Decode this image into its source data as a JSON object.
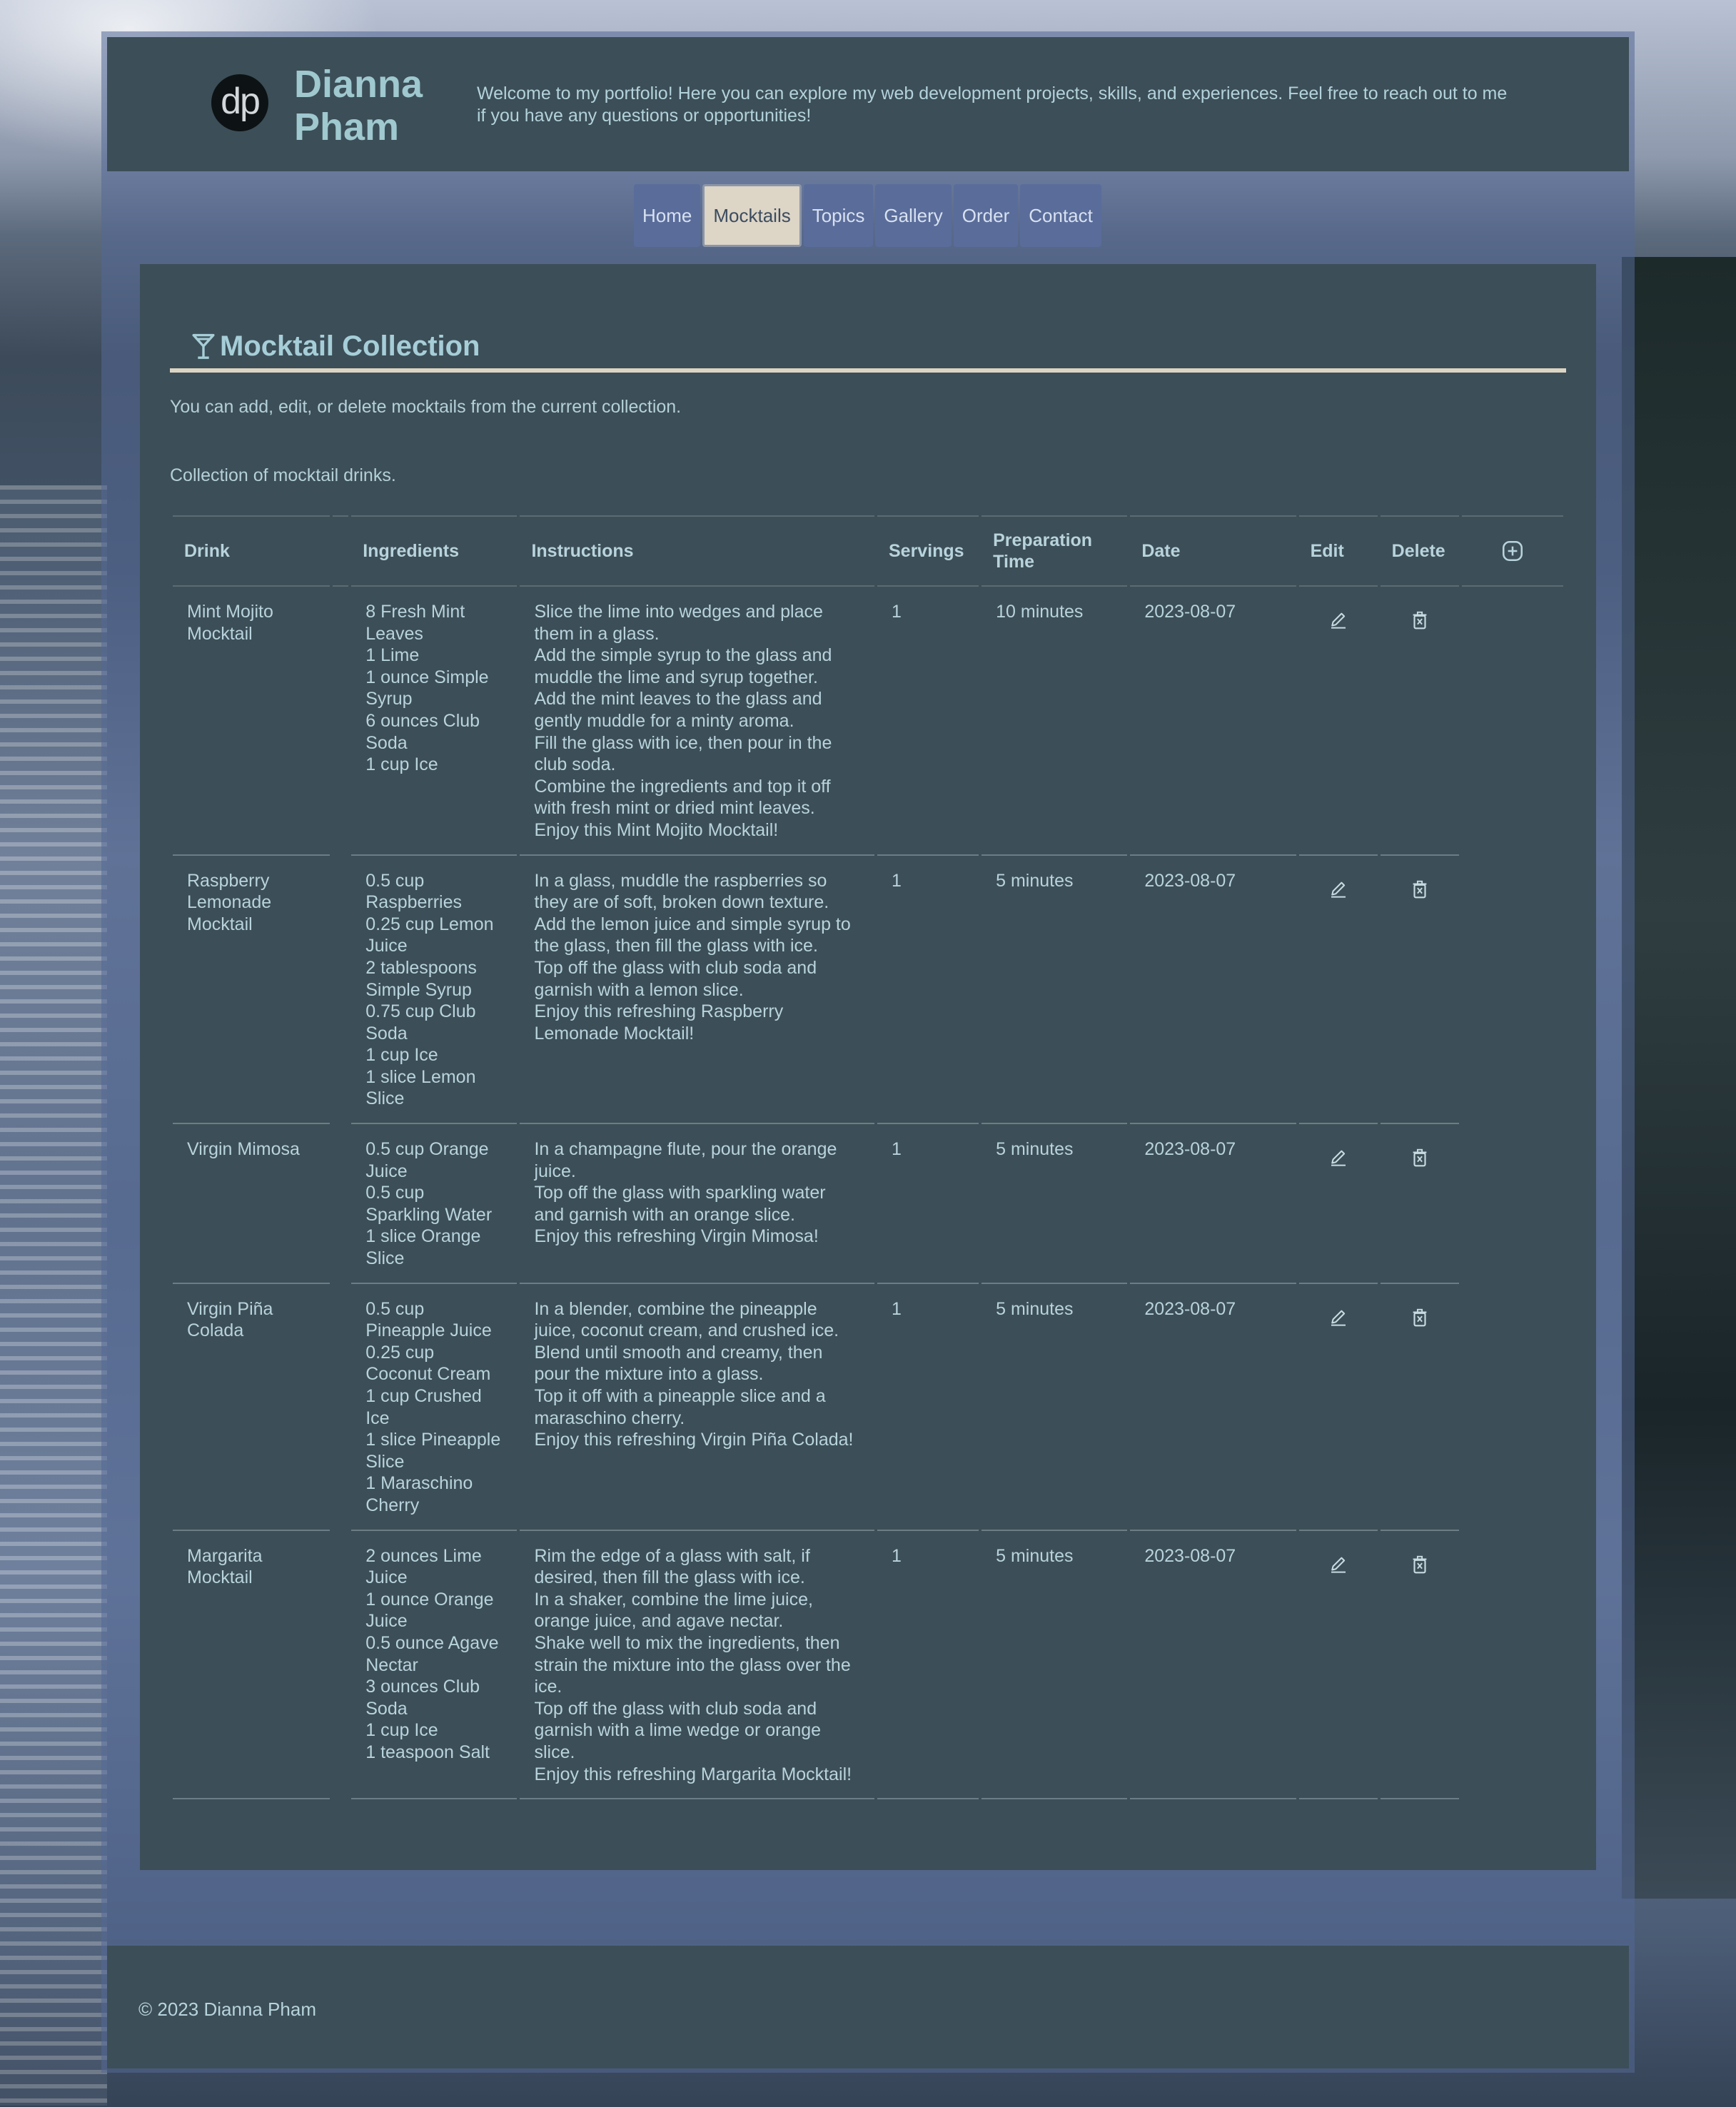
{
  "header": {
    "logo_text": "dp",
    "name_line1": "Dianna",
    "name_line2": "Pham",
    "welcome": "Welcome to my portfolio! Here you can explore my web development projects, skills, and experiences. Feel free to reach out to me if you have any questions or opportunities!"
  },
  "nav": {
    "items": [
      {
        "label": "Home"
      },
      {
        "label": "Mocktails"
      },
      {
        "label": "Topics"
      },
      {
        "label": "Gallery"
      },
      {
        "label": "Order"
      },
      {
        "label": "Contact"
      }
    ],
    "active": "Mocktails"
  },
  "main": {
    "title": "Mocktail Collection",
    "title_icon": "cocktail-glass-icon",
    "intro": "You can add, edit, or delete mocktails from the current collection.",
    "caption": "Collection of mocktail drinks."
  },
  "table": {
    "headers": {
      "drink": "Drink",
      "ingredients": "Ingredients",
      "instructions": "Instructions",
      "servings": "Servings",
      "prep_time": "Preparation Time",
      "date": "Date",
      "edit": "Edit",
      "delete": "Delete",
      "add_icon": "plus-circle-icon"
    },
    "rows": [
      {
        "drink": "Mint Mojito Mocktail",
        "ingredients": [
          "8 Fresh Mint Leaves",
          "1 Lime",
          "1 ounce Simple Syrup",
          "6 ounces Club Soda",
          "1 cup Ice"
        ],
        "instructions": [
          "Slice the lime into wedges and place them in a glass.",
          "Add the simple syrup to the glass and muddle the lime and syrup together.",
          "Add the mint leaves to the glass and gently muddle for a minty aroma.",
          "Fill the glass with ice, then pour in the club soda.",
          "Combine the ingredients and top it off with fresh mint or dried mint leaves.",
          "Enjoy this Mint Mojito Mocktail!"
        ],
        "servings": "1",
        "prep_time": "10 minutes",
        "date": "2023-08-07"
      },
      {
        "drink": "Raspberry Lemonade Mocktail",
        "ingredients": [
          "0.5 cup Raspberries",
          "0.25 cup Lemon Juice",
          "2 tablespoons Simple Syrup",
          "0.75 cup Club Soda",
          "1 cup Ice",
          "1 slice Lemon Slice"
        ],
        "instructions": [
          "In a glass, muddle the raspberries so they are of soft, broken down texture.",
          "Add the lemon juice and simple syrup to the glass, then fill the glass with ice.",
          "Top off the glass with club soda and garnish with a lemon slice.",
          "Enjoy this refreshing Raspberry Lemonade Mocktail!"
        ],
        "servings": "1",
        "prep_time": "5 minutes",
        "date": "2023-08-07"
      },
      {
        "drink": "Virgin Mimosa",
        "ingredients": [
          "0.5 cup Orange Juice",
          "0.5 cup Sparkling Water",
          "1 slice Orange Slice"
        ],
        "instructions": [
          "In a champagne flute, pour the orange juice.",
          "Top off the glass with sparkling water and garnish with an orange slice.",
          "Enjoy this refreshing Virgin Mimosa!"
        ],
        "servings": "1",
        "prep_time": "5 minutes",
        "date": "2023-08-07"
      },
      {
        "drink": "Virgin Piña Colada",
        "ingredients": [
          "0.5 cup Pineapple Juice",
          "0.25 cup Coconut Cream",
          "1 cup Crushed Ice",
          "1 slice Pineapple Slice",
          "1 Maraschino Cherry"
        ],
        "instructions": [
          "In a blender, combine the pineapple juice, coconut cream, and crushed ice.",
          "Blend until smooth and creamy, then pour the mixture into a glass.",
          "Top it off with a pineapple slice and a maraschino cherry.",
          "Enjoy this refreshing Virgin Piña Colada!"
        ],
        "servings": "1",
        "prep_time": "5 minutes",
        "date": "2023-08-07"
      },
      {
        "drink": "Margarita Mocktail",
        "ingredients": [
          "2 ounces Lime Juice",
          "1 ounce Orange Juice",
          "0.5 ounce Agave Nectar",
          "3 ounces Club Soda",
          "1 cup Ice",
          "1 teaspoon Salt"
        ],
        "instructions": [
          "Rim the edge of a glass with salt, if desired, then fill the glass with ice.",
          "In a shaker, combine the lime juice, orange juice, and agave nectar.",
          "Shake well to mix the ingredients, then strain the mixture into the glass over the ice.",
          "Top off the glass with club soda and garnish with a lime wedge or orange slice.",
          "Enjoy this refreshing Margarita Mocktail!"
        ],
        "servings": "1",
        "prep_time": "5 minutes",
        "date": "2023-08-07"
      }
    ]
  },
  "footer": {
    "copyright": "© 2023 Dianna Pham"
  },
  "colors": {
    "panel": "#3c4e57",
    "accent_text": "#a6ced8",
    "nav_tab": "#5a6c9a",
    "nav_active": "#ddd5c6",
    "title_rule": "#dcd4c3"
  }
}
